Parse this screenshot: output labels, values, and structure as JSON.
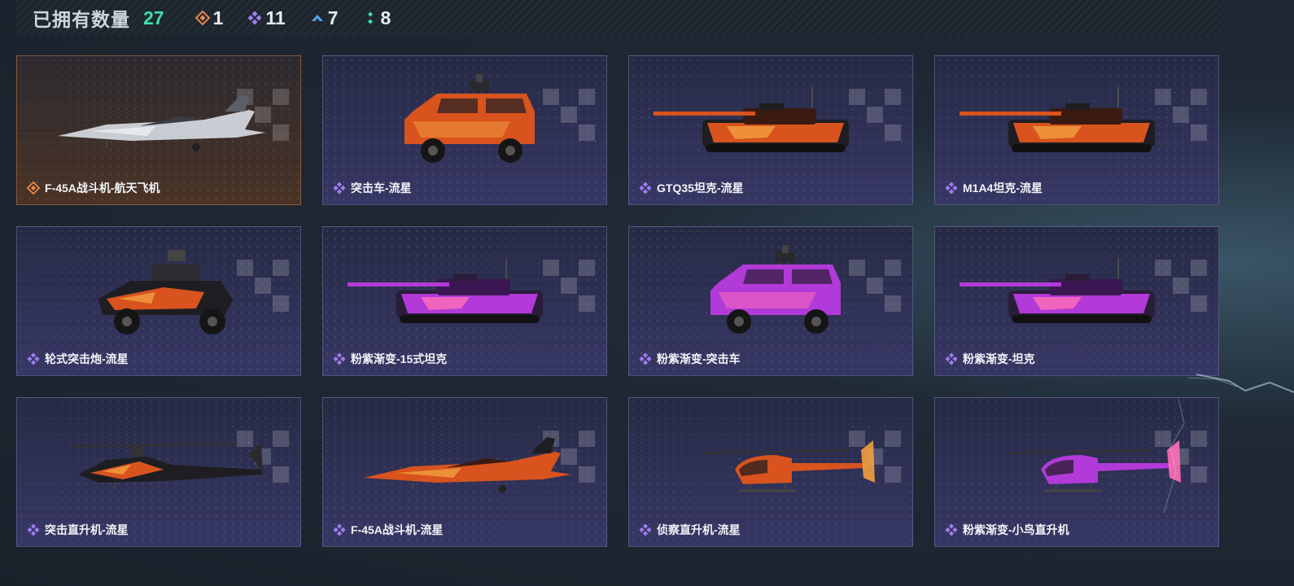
{
  "header": {
    "title": "已拥有数量",
    "total": "27",
    "rarities": [
      {
        "icon": "orange-diamond-icon",
        "color": "#e8884a",
        "count": "1"
      },
      {
        "icon": "purple-diamond-icon",
        "color": "#9f7cf0",
        "count": "11"
      },
      {
        "icon": "blue-chevron-icon",
        "color": "#5aa2ee",
        "count": "7"
      },
      {
        "icon": "green-dots-icon",
        "color": "#3fe0a8",
        "count": "8"
      }
    ]
  },
  "items": [
    {
      "name": "F-45A战斗机-航天飞机",
      "rarity": "gold",
      "kind": "jet",
      "skin": "silver"
    },
    {
      "name": "突击车-流星",
      "rarity": "purple",
      "kind": "truck",
      "skin": "fire"
    },
    {
      "name": "GTQ35坦克-流星",
      "rarity": "purple",
      "kind": "tank",
      "skin": "fire"
    },
    {
      "name": "M1A4坦克-流星",
      "rarity": "purple",
      "kind": "tank",
      "skin": "fire"
    },
    {
      "name": "轮式突击炮-流星",
      "rarity": "purple",
      "kind": "buggy",
      "skin": "fire"
    },
    {
      "name": "粉紫渐变-15式坦克",
      "rarity": "purple",
      "kind": "tank",
      "skin": "pink"
    },
    {
      "name": "粉紫渐变-突击车",
      "rarity": "purple",
      "kind": "truck",
      "skin": "pink"
    },
    {
      "name": "粉紫渐变-坦克",
      "rarity": "purple",
      "kind": "tank",
      "skin": "pink"
    },
    {
      "name": "突击直升机-流星",
      "rarity": "purple",
      "kind": "apache",
      "skin": "fire"
    },
    {
      "name": "F-45A战斗机-流星",
      "rarity": "purple",
      "kind": "jet",
      "skin": "fire"
    },
    {
      "name": "侦察直升机-流星",
      "rarity": "purple",
      "kind": "heli",
      "skin": "fire"
    },
    {
      "name": "粉紫渐变-小鸟直升机",
      "rarity": "purple",
      "kind": "heli",
      "skin": "pink"
    }
  ]
}
